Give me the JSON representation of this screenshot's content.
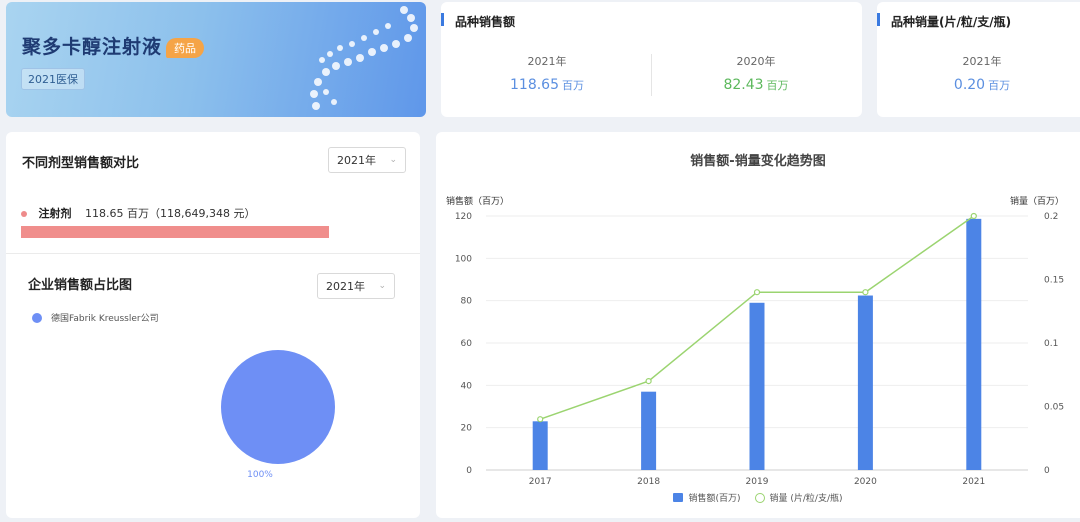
{
  "hero": {
    "title": "聚多卡醇注射液",
    "tag": "药品",
    "badge": "2021医保"
  },
  "sales_card": {
    "title": "品种销售额",
    "items": [
      {
        "year": "2021年",
        "value": "118.65",
        "unit": "百万",
        "color": "#5b8fe0"
      },
      {
        "year": "2020年",
        "value": "82.43",
        "unit": "百万",
        "color": "#5cb85c"
      }
    ]
  },
  "volume_card": {
    "title": "品种销量(片/粒/支/瓶)",
    "items": [
      {
        "year": "2021年",
        "value": "0.20",
        "unit": "百万",
        "color": "#5b8fe0"
      }
    ]
  },
  "dosage_panel": {
    "title": "不同剂型销售额对比",
    "select_value": "2021年",
    "row_label": "注射剂",
    "row_value": "118.65 百万（118,649,348 元）",
    "bar_fraction": 1.0,
    "bar_color": "#f08e8c"
  },
  "company_panel": {
    "title": "企业销售额占比图",
    "select_value": "2021年",
    "legend_label": "德国Fabrik Kreussler公司",
    "legend_color": "#6e8ff5",
    "pie_label": "100%"
  },
  "trend_panel": {
    "title": "销售额-销量变化趋势图",
    "left_axis_label": "销售额（百万）",
    "right_axis_label": "销量（百万）"
  },
  "chart_data": {
    "type": "bar",
    "title": "销售额-销量变化趋势图",
    "categories": [
      "2017",
      "2018",
      "2019",
      "2020",
      "2021"
    ],
    "series": [
      {
        "name": "销售额(百万)",
        "type": "bar",
        "axis": "left",
        "color": "#4c84e6",
        "values": [
          23,
          37,
          79,
          82.43,
          118.65
        ]
      },
      {
        "name": "销量 (片/粒/支/瓶)",
        "type": "line",
        "axis": "right",
        "color": "#9bd470",
        "values": [
          0.04,
          0.07,
          0.14,
          0.14,
          0.2
        ]
      }
    ],
    "ylim_left": [
      0,
      120
    ],
    "yticks_left": [
      "0",
      "20",
      "40",
      "60",
      "80",
      "100",
      "120"
    ],
    "ylim_right": [
      0,
      0.2
    ],
    "yticks_right": [
      "0",
      "0.05",
      "0.1",
      "0.15",
      "0.2"
    ],
    "legend_position": "bottom",
    "grid": true
  }
}
